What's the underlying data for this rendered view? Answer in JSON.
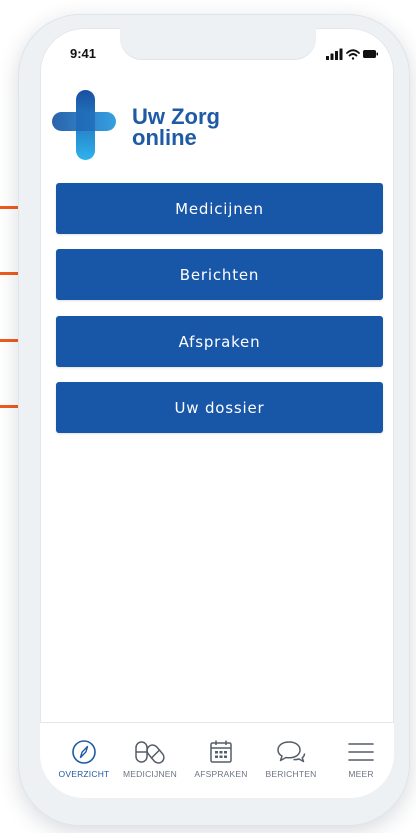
{
  "status_bar": {
    "time": "9:41"
  },
  "brand": {
    "line1": "Uw Zorg",
    "line2": "online",
    "logo_colors": [
      "#1a4fa0",
      "#2a9be0"
    ]
  },
  "menu": [
    {
      "label": "Medicijnen"
    },
    {
      "label": "Berichten"
    },
    {
      "label": "Afspraken"
    },
    {
      "label": "Uw dossier"
    }
  ],
  "tabbar": {
    "active": "OVERZICHT",
    "items": [
      {
        "label": "OVERZICHT",
        "icon": "compass-icon"
      },
      {
        "label": "MEDICIJNEN",
        "icon": "pills-icon"
      },
      {
        "label": "AFSPRAKEN",
        "icon": "calendar-icon"
      },
      {
        "label": "BERICHTEN",
        "icon": "chat-bubbles-icon"
      },
      {
        "label": "MEER",
        "icon": "hamburger-icon"
      }
    ]
  },
  "colors": {
    "button": "#1856a8",
    "pointer": "#ee5b1c",
    "accent": "#1f5aa6"
  }
}
